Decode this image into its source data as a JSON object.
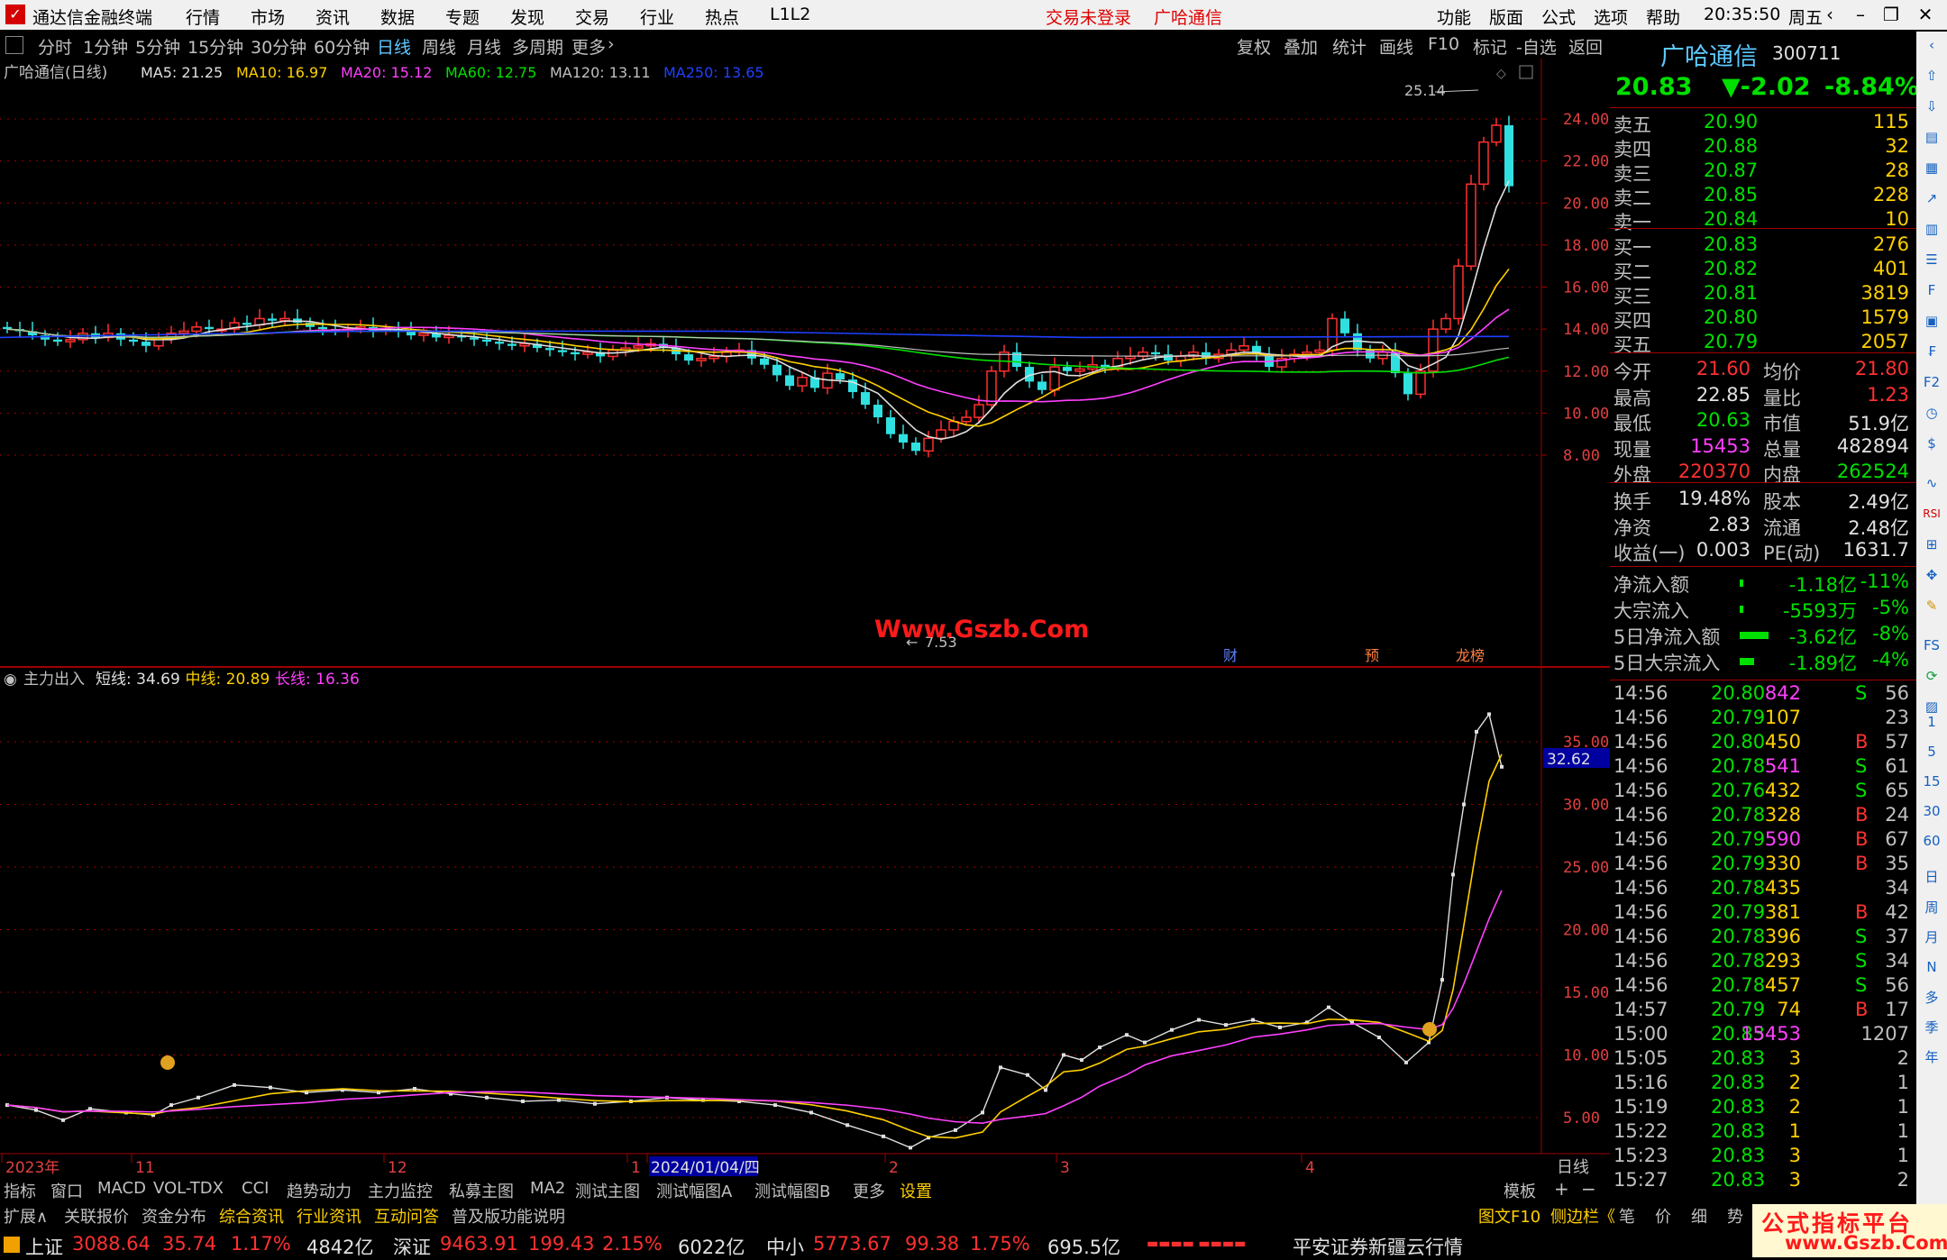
{
  "titlebar": {
    "app_title": "通达信金融终端",
    "menus": [
      "行情",
      "市场",
      "资讯",
      "数据",
      "专题",
      "发现",
      "交易",
      "行业",
      "热点",
      "L1L2"
    ],
    "login_status": "交易未登录",
    "stock_name": "广哈通信",
    "right_menus": [
      "功能",
      "版面",
      "公式",
      "选项",
      "帮助"
    ],
    "time": "20:35:50",
    "weekday": "周五"
  },
  "periods": [
    "分时",
    "1分钟",
    "5分钟",
    "15分钟",
    "30分钟",
    "60分钟",
    "日线",
    "周线",
    "月线",
    "多周期",
    "更多"
  ],
  "active_period": "日线",
  "tools": [
    "复权",
    "叠加",
    "统计",
    "画线",
    "F10",
    "标记",
    "-自选",
    "返回"
  ],
  "main_chart": {
    "title": "广哈通信(日线)",
    "ma_labels": [
      {
        "text": "MA5: 21.25",
        "color": "#e0e0e0"
      },
      {
        "text": "MA10: 16.97",
        "color": "#ffd000"
      },
      {
        "text": "MA20: 15.12",
        "color": "#ff40ff"
      },
      {
        "text": "MA60: 12.75",
        "color": "#00e000"
      },
      {
        "text": "MA120: 13.11",
        "color": "#c0c0c0"
      },
      {
        "text": "MA250: 13.65",
        "color": "#2040ff"
      }
    ],
    "y_ticks": [
      "24.00",
      "22.00",
      "20.00",
      "18.00",
      "16.00",
      "14.00",
      "12.00",
      "10.00",
      "8.00"
    ],
    "high_label": "25.14",
    "low_label": "7.53",
    "event_marks": [
      "财",
      "预",
      "龙榜"
    ]
  },
  "sub_chart": {
    "indicator": "主力出入",
    "labels": [
      {
        "text": "短线: 34.69",
        "color": "#e0e0e0"
      },
      {
        "text": "中线: 20.89",
        "color": "#ffd000"
      },
      {
        "text": "长线: 16.36",
        "color": "#ff40ff"
      }
    ],
    "y_ticks": [
      "35.00",
      "30.00",
      "25.00",
      "20.00",
      "15.00",
      "10.00",
      "5.00"
    ],
    "current_value": "32.62"
  },
  "x_axis": {
    "labels": [
      "2023年",
      "11",
      "12",
      "1",
      "2024/01/04/四",
      "2",
      "3",
      "4"
    ],
    "period_label": "日线"
  },
  "indicator_tabs": [
    "指标",
    "窗口",
    "MACD",
    "VOL-TDX",
    "CCI",
    "趋势动力",
    "主力监控",
    "私募主图",
    "MA2",
    "测试主图",
    "测试幅图A",
    "测试幅图B",
    "更多",
    "设置"
  ],
  "template_tab": "模板",
  "ext_tabs": [
    "扩展∧",
    "关联报价",
    "资金分布",
    "综合资讯",
    "行业资讯",
    "互动问答",
    "普及版功能说明"
  ],
  "ext_tab_colors": [
    "#c0c0c0",
    "#c0c0c0",
    "#c0c0c0",
    "#ffd000",
    "#ffd000",
    "#ffd000",
    "#c0c0c0"
  ],
  "right_tabs": [
    "图文F10",
    "侧边栏《",
    "笔",
    "价",
    "细",
    "势"
  ],
  "quote": {
    "name": "广哈通信",
    "code": "300711",
    "price": "20.83",
    "change": "▼-2.02",
    "change_pct": "-8.84%",
    "asks": [
      {
        "label": "卖五",
        "price": "20.90",
        "vol": "115"
      },
      {
        "label": "卖四",
        "price": "20.88",
        "vol": "32"
      },
      {
        "label": "卖三",
        "price": "20.87",
        "vol": "28"
      },
      {
        "label": "卖二",
        "price": "20.85",
        "vol": "228"
      },
      {
        "label": "卖一",
        "price": "20.84",
        "vol": "10"
      }
    ],
    "bids": [
      {
        "label": "买一",
        "price": "20.83",
        "vol": "276"
      },
      {
        "label": "买二",
        "price": "20.82",
        "vol": "401"
      },
      {
        "label": "买三",
        "price": "20.81",
        "vol": "3819"
      },
      {
        "label": "买四",
        "price": "20.80",
        "vol": "1579"
      },
      {
        "label": "买五",
        "price": "20.79",
        "vol": "2057"
      }
    ],
    "stats": [
      {
        "l1": "今开",
        "v1": "21.60",
        "c1": "red",
        "l2": "均价",
        "v2": "21.80",
        "c2": "red"
      },
      {
        "l1": "最高",
        "v1": "22.85",
        "c1": "wht",
        "l2": "量比",
        "v2": "1.23",
        "c2": "red"
      },
      {
        "l1": "最低",
        "v1": "20.63",
        "c1": "grn",
        "l2": "市值",
        "v2": "51.9亿",
        "c2": "wht"
      },
      {
        "l1": "现量",
        "v1": "15453",
        "c1": "mag",
        "l2": "总量",
        "v2": "482894",
        "c2": "wht"
      },
      {
        "l1": "外盘",
        "v1": "220370",
        "c1": "red",
        "l2": "内盘",
        "v2": "262524",
        "c2": "grn"
      }
    ],
    "stats2": [
      {
        "l1": "换手",
        "v1": "19.48%",
        "l2": "股本",
        "v2": "2.49亿"
      },
      {
        "l1": "净资",
        "v1": "2.83",
        "l2": "流通",
        "v2": "2.48亿"
      },
      {
        "l1": "收益(一)",
        "v1": "0.003",
        "l2": "PE(动)",
        "v2": "1631.7"
      }
    ],
    "flows": [
      {
        "label": "净流入额",
        "value": "-1.18亿",
        "pct": "-11%",
        "bar": 0.11
      },
      {
        "label": "大宗流入",
        "value": "-5593万",
        "pct": "-5%",
        "bar": 0.05
      },
      {
        "label": "5日净流入额",
        "value": "-3.62亿",
        "pct": "-8%",
        "bar": 0.8
      },
      {
        "label": "5日大宗流入",
        "value": "-1.89亿",
        "pct": "-4%",
        "bar": 0.4
      }
    ]
  },
  "ticks": [
    {
      "t": "14:56",
      "p": "20.80",
      "v": "842",
      "vc": "mag",
      "s": "S",
      "n": "56"
    },
    {
      "t": "14:56",
      "p": "20.79",
      "v": "107",
      "vc": "yel",
      "s": "",
      "n": "23"
    },
    {
      "t": "14:56",
      "p": "20.80",
      "v": "450",
      "vc": "yel",
      "s": "B",
      "n": "57"
    },
    {
      "t": "14:56",
      "p": "20.78",
      "v": "541",
      "vc": "mag",
      "s": "S",
      "n": "61"
    },
    {
      "t": "14:56",
      "p": "20.76",
      "v": "432",
      "vc": "yel",
      "s": "S",
      "n": "65"
    },
    {
      "t": "14:56",
      "p": "20.78",
      "v": "328",
      "vc": "yel",
      "s": "B",
      "n": "24"
    },
    {
      "t": "14:56",
      "p": "20.79",
      "v": "590",
      "vc": "mag",
      "s": "B",
      "n": "67"
    },
    {
      "t": "14:56",
      "p": "20.79",
      "v": "330",
      "vc": "yel",
      "s": "B",
      "n": "35"
    },
    {
      "t": "14:56",
      "p": "20.78",
      "v": "435",
      "vc": "yel",
      "s": "",
      "n": "34"
    },
    {
      "t": "14:56",
      "p": "20.79",
      "v": "381",
      "vc": "yel",
      "s": "B",
      "n": "42"
    },
    {
      "t": "14:56",
      "p": "20.78",
      "v": "396",
      "vc": "yel",
      "s": "S",
      "n": "37"
    },
    {
      "t": "14:56",
      "p": "20.78",
      "v": "293",
      "vc": "yel",
      "s": "S",
      "n": "34"
    },
    {
      "t": "14:56",
      "p": "20.78",
      "v": "457",
      "vc": "yel",
      "s": "S",
      "n": "56"
    },
    {
      "t": "14:57",
      "p": "20.79",
      "v": "74",
      "vc": "yel",
      "s": "B",
      "n": "17"
    },
    {
      "t": "15:00",
      "p": "20.83",
      "v": "15453",
      "vc": "mag",
      "s": "",
      "n": "1207"
    },
    {
      "t": "15:05",
      "p": "20.83",
      "v": "3",
      "vc": "yel",
      "s": "",
      "n": "2"
    },
    {
      "t": "15:16",
      "p": "20.83",
      "v": "2",
      "vc": "yel",
      "s": "",
      "n": "1"
    },
    {
      "t": "15:19",
      "p": "20.83",
      "v": "2",
      "vc": "yel",
      "s": "",
      "n": "1"
    },
    {
      "t": "15:22",
      "p": "20.83",
      "v": "1",
      "vc": "yel",
      "s": "",
      "n": "1"
    },
    {
      "t": "15:23",
      "p": "20.83",
      "v": "3",
      "vc": "yel",
      "s": "",
      "n": "1"
    },
    {
      "t": "15:27",
      "p": "20.83",
      "v": "3",
      "vc": "yel",
      "s": "",
      "n": "2"
    }
  ],
  "side_icons": [
    "1",
    "5",
    "15",
    "30",
    "60",
    "日",
    "周",
    "月",
    "N",
    "多",
    "季",
    "年"
  ],
  "status": {
    "sh_name": "上证",
    "sh_val": "3088.64",
    "sh_chg": "35.74",
    "sh_pct": "1.17%",
    "sh_amt": "4842亿",
    "sz_name": "深证",
    "sz_val": "9463.91",
    "sz_chg": "199.43",
    "sz_pct": "2.15%",
    "sz_amt": "6022亿",
    "zx_name": "中小",
    "zx_val": "5773.67",
    "zx_chg": "99.38",
    "zx_pct": "1.75%",
    "zx_amt": "695.5亿",
    "broker": "平安证券新疆云行情"
  },
  "watermark": "Www.Gszb.Com",
  "watermark2": "公式指标平台",
  "watermark3": "www.Gszb.Com"
}
